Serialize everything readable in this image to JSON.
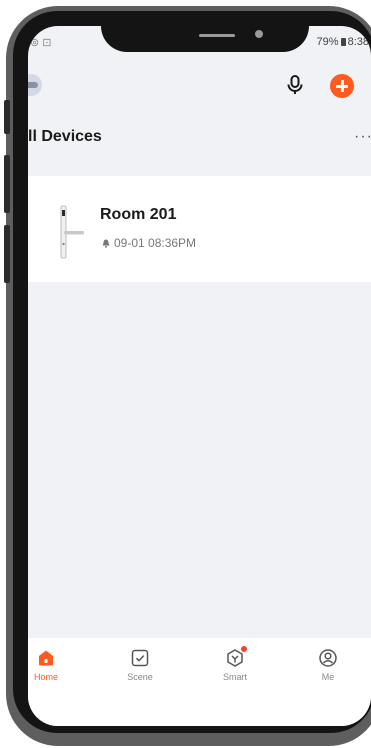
{
  "status_bar": {
    "left_icons": "⊚ ⊡",
    "battery_text": "79%",
    "time": "8:38"
  },
  "header": {
    "title": "ll Devices",
    "more": "···"
  },
  "devices": [
    {
      "name": "Room 201",
      "last_event": "09-01 08:36PM",
      "icon": "door-lock-image"
    }
  ],
  "tabbar": {
    "tabs": [
      {
        "label": "Home",
        "icon": "home-icon",
        "active": true
      },
      {
        "label": "Scene",
        "icon": "scene-icon",
        "active": false
      },
      {
        "label": "Smart",
        "icon": "smart-icon",
        "active": false
      },
      {
        "label": "Me",
        "icon": "profile-icon",
        "active": false
      }
    ]
  },
  "colors": {
    "accent": "#ff5a1f",
    "background": "#f1f2f6",
    "card": "#ffffff",
    "frame": "#5e5e5e"
  }
}
